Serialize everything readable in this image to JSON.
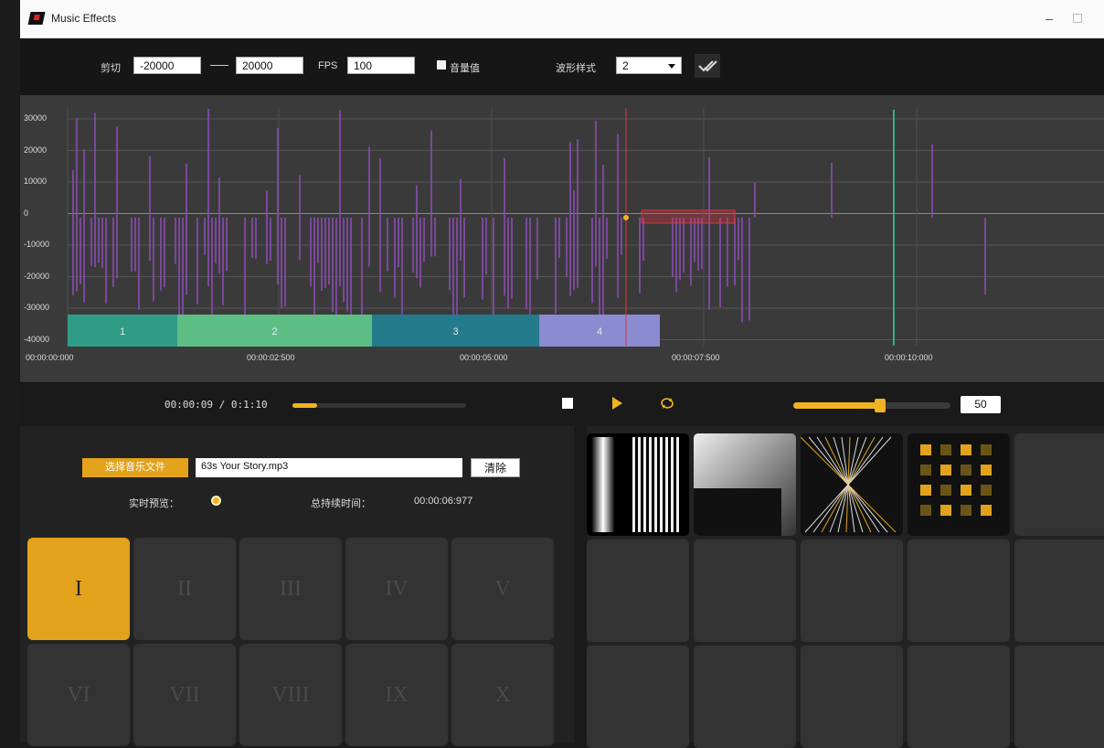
{
  "window": {
    "title": "Music Effects",
    "minimize_glyph": "–"
  },
  "toolbar": {
    "trim_label": "剪切",
    "trim_start": "-20000",
    "trim_end": "20000",
    "fps_label": "FPS",
    "fps_value": "100",
    "volume_value_label": "音量值",
    "waveform_style_label": "波形样式",
    "waveform_style_value": "2"
  },
  "waveform": {
    "y_ticks": [
      "30000",
      "20000",
      "10000",
      "0",
      "-10000",
      "-20000",
      "-30000",
      "-40000"
    ],
    "x_ticks": [
      "00:00:00:000",
      "00:00:02:500",
      "00:00:05:000",
      "00:00:07:500",
      "00:00:10:000"
    ],
    "segments": [
      {
        "label": "1",
        "color": "#2f9c86"
      },
      {
        "label": "2",
        "color": "#5ebf86"
      },
      {
        "label": "3",
        "color": "#237b8c"
      },
      {
        "label": "4",
        "color": "#8b8bd1"
      }
    ],
    "bar_color": "#8a4cb3",
    "playhead_color": "#d9363e",
    "marker_color": "#3ecf94"
  },
  "transport": {
    "time": "00:00:09 / 0:1:10",
    "progress": 0.14,
    "volume": "50",
    "volume_fraction": 0.55,
    "accent": "#f0b323"
  },
  "file_panel": {
    "choose_button": "选择音乐文件",
    "file_name": "63s Your Story.mp3",
    "clear_button": "清除",
    "realtime_label": "实时预览：",
    "duration_label": "总持续时间：",
    "duration_value": "00:00:06:977"
  },
  "presets": [
    {
      "label": "I",
      "active": true
    },
    {
      "label": "II",
      "active": false
    },
    {
      "label": "III",
      "active": false
    },
    {
      "label": "IV",
      "active": false
    },
    {
      "label": "V",
      "active": false
    },
    {
      "label": "VI",
      "active": false
    },
    {
      "label": "VII",
      "active": false
    },
    {
      "label": "VIII",
      "active": false
    },
    {
      "label": "IX",
      "active": false
    },
    {
      "label": "X",
      "active": false
    }
  ],
  "effects": [
    {
      "name": "vertical-stripes-effect",
      "style": "stripes"
    },
    {
      "name": "radial-gradient-effect",
      "style": "radial"
    },
    {
      "name": "x-lines-effect",
      "style": "xlines"
    },
    {
      "name": "dot-grid-effect",
      "style": "dots"
    }
  ]
}
